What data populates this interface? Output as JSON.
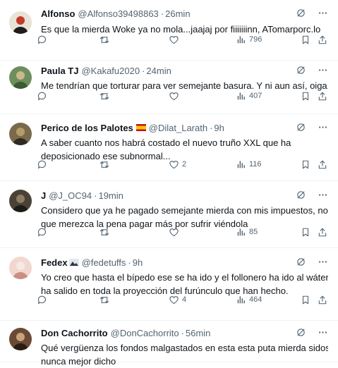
{
  "tweets": [
    {
      "name": "Alfonso",
      "handle": "@Alfonso39498863",
      "time": "26min",
      "text_lines": [
        "Es que la mierda Woke ya no mola...jaajaj por fiiiiiiinn, ATomarporc.lo"
      ],
      "replies": "",
      "retweets": "",
      "likes": "",
      "views": "796",
      "avatar_colors": [
        "#e8e3d6",
        "#1d1d1b",
        "#c23a2b"
      ]
    },
    {
      "name": "Paula TJ",
      "handle": "@Kakafu2020",
      "time": "24min",
      "text_lines": [
        "Me tendrían que torturar para ver semejante basura. Y ni aun así, oiga..."
      ],
      "replies": "",
      "retweets": "",
      "likes": "",
      "views": "407",
      "avatar_colors": [
        "#6f8e5e",
        "#3c5a35",
        "#c9b98c"
      ]
    },
    {
      "name": "Perico de los Palotes",
      "flag": true,
      "handle": "@Dilat_Larath",
      "time": "9h",
      "text_lines": [
        "A saber cuanto nos habrá costado el nuevo truño XXL que ha",
        "deposicionado ese subnormal..."
      ],
      "replies": "",
      "retweets": "",
      "likes": "2",
      "views": "116",
      "avatar_colors": [
        "#7a6a4c",
        "#2f2a22",
        "#b59b6a"
      ]
    },
    {
      "name": "J",
      "handle": "@J_OC94",
      "time": "19min",
      "text_lines": [
        "Considero que ya he pagado semejante mierda con mis impuestos, no creo",
        "que merezca la pena pagar más por sufrir viéndola"
      ],
      "replies": "",
      "retweets": "",
      "likes": "",
      "views": "85",
      "avatar_colors": [
        "#4a4236",
        "#1e1b17",
        "#8d7c62"
      ]
    },
    {
      "name": "Fedex",
      "badge": true,
      "handle": "@fedetuffs",
      "time": "9h",
      "text_lines": [
        "Yo creo que hasta el bípedo ese se ha ido y el follonero ha ido al wáter y no",
        "ha salido en toda la proyección del furúnculo que han hecho."
      ],
      "replies": "",
      "retweets": "",
      "likes": "4",
      "views": "464",
      "avatar_colors": [
        "#f1d7cf",
        "#c98f84",
        "#f6e9e3"
      ]
    },
    {
      "name": "Don Cachorrito",
      "handle": "@DonCachorrito",
      "time": "56min",
      "text_lines": [
        "Qué vergüenza los fondos malgastados en esta esta puta mierda sidosa,",
        "nunca mejor dicho"
      ],
      "avatar_colors": [
        "#6b4a34",
        "#2a1c12",
        "#c8a27c"
      ]
    }
  ],
  "icon_color": "#536471"
}
